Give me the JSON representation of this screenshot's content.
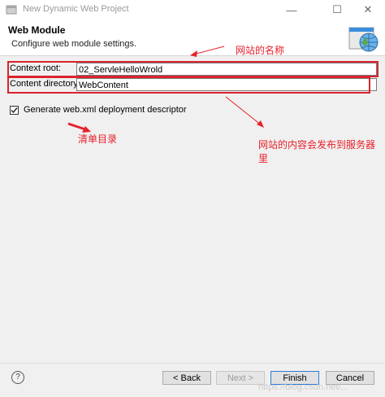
{
  "window": {
    "title": "New Dynamic Web Project",
    "min_glyph": "—",
    "max_glyph": "☐",
    "close_glyph": "✕"
  },
  "header": {
    "title": "Web Module",
    "subtitle": "Configure web module settings."
  },
  "form": {
    "context_root_label": "Context root:",
    "context_root_value": "02_ServleHelloWrold",
    "content_dir_label": "Content directory:",
    "content_dir_value": "WebContent",
    "generate_label": "Generate web.xml deployment descriptor",
    "generate_checked": true
  },
  "annotations": {
    "site_name": "网站的名称",
    "manifest": "清单目录",
    "publish_line1": "网站的内容会发布到服务器",
    "publish_line2": "里",
    "color": "#e8202a"
  },
  "footer": {
    "help_glyph": "?",
    "back_label": "< Back",
    "next_label": "Next >",
    "finish_label": "Finish",
    "cancel_label": "Cancel",
    "watermark": "https://blog.csdn.net/..."
  }
}
